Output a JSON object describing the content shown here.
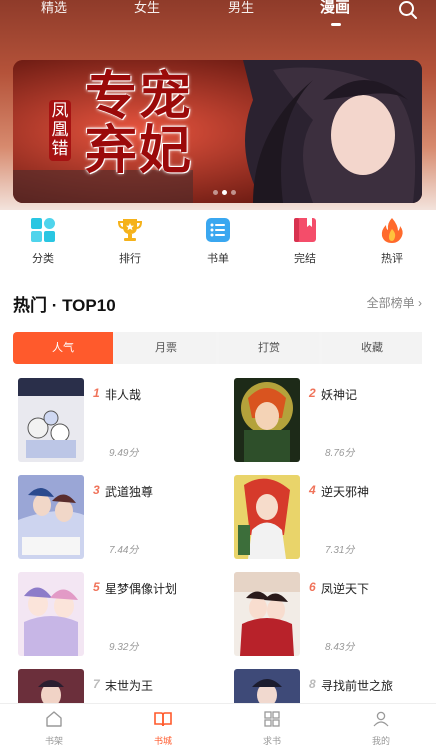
{
  "top_nav": {
    "tabs": [
      {
        "label": "精选"
      },
      {
        "label": "女生"
      },
      {
        "label": "男生"
      },
      {
        "label": "漫画"
      }
    ],
    "active_index": 3
  },
  "banner": {
    "title": "专宠弃妃",
    "subtitle": "凤凰错",
    "slide_count": 3,
    "active_slide": 1
  },
  "quick_menu": [
    {
      "label": "分类",
      "icon": "category-grid-icon"
    },
    {
      "label": "排行",
      "icon": "trophy-icon"
    },
    {
      "label": "书单",
      "icon": "book-list-icon"
    },
    {
      "label": "完结",
      "icon": "finished-book-icon"
    },
    {
      "label": "热评",
      "icon": "flame-icon"
    }
  ],
  "hot": {
    "title": "热门 · TOP10",
    "more": "全部榜单 ›",
    "tabs": [
      "人气",
      "月票",
      "打赏",
      "收藏"
    ],
    "active_tab": 0,
    "books": [
      {
        "rank": "1",
        "name": "非人哉",
        "score": "9.49分"
      },
      {
        "rank": "2",
        "name": "妖神记",
        "score": "8.76分"
      },
      {
        "rank": "3",
        "name": "武道独尊",
        "score": "7.44分"
      },
      {
        "rank": "4",
        "name": "逆天邪神",
        "score": "7.31分"
      },
      {
        "rank": "5",
        "name": "星梦偶像计划",
        "score": "9.32分"
      },
      {
        "rank": "6",
        "name": "凤逆天下",
        "score": "8.43分"
      },
      {
        "rank": "7",
        "name": "末世为王",
        "score": ""
      },
      {
        "rank": "8",
        "name": "寻找前世之旅",
        "score": ""
      }
    ]
  },
  "bottom_nav": {
    "items": [
      {
        "label": "书架",
        "icon": "bookshelf-icon"
      },
      {
        "label": "书城",
        "icon": "bookstore-icon"
      },
      {
        "label": "求书",
        "icon": "request-book-icon"
      },
      {
        "label": "我的",
        "icon": "profile-icon"
      }
    ],
    "active_index": 1
  },
  "colors": {
    "accent": "#ff5a2c",
    "rank_top3": "#f0735a"
  }
}
